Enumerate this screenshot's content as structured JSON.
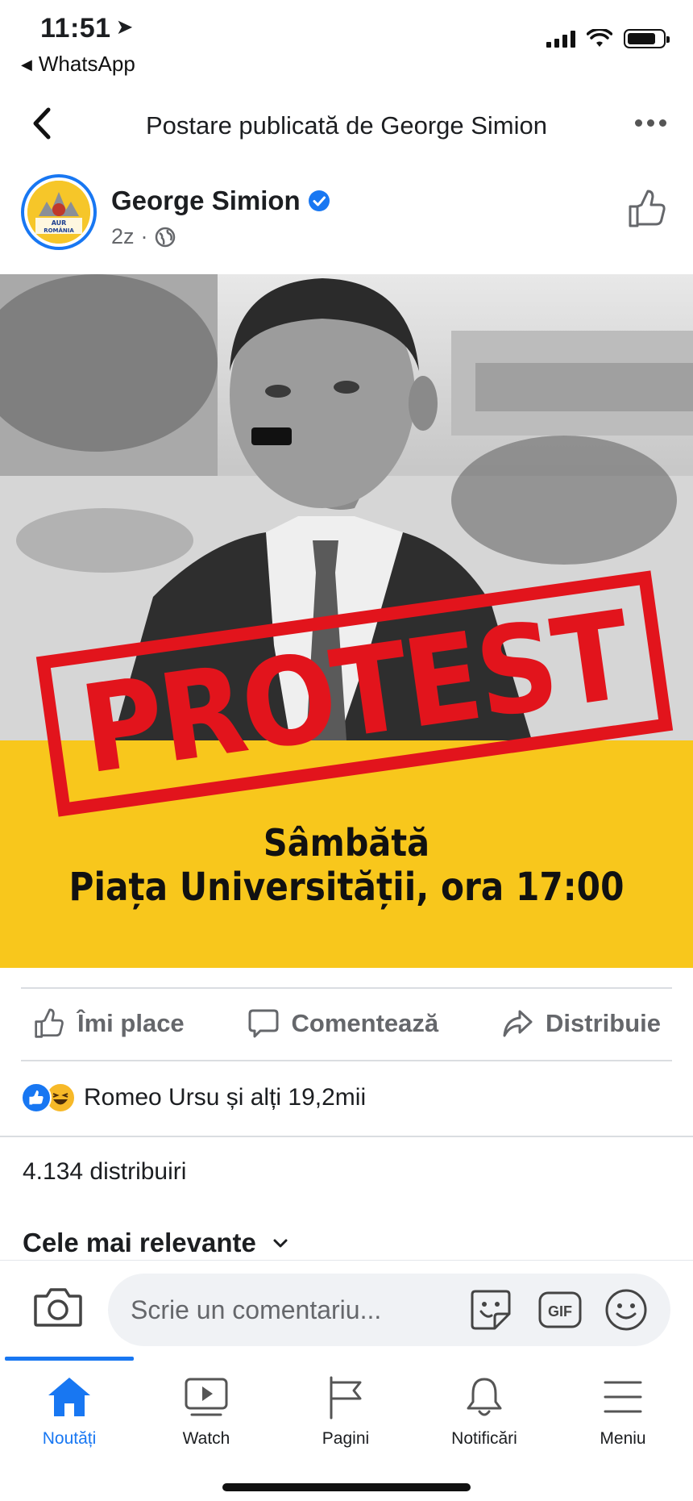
{
  "status_bar": {
    "time": "11:51",
    "back_app": "WhatsApp"
  },
  "header": {
    "title": "Postare publicată de George Simion"
  },
  "post": {
    "author": "George Simion",
    "time_ago": "2z",
    "meta_separator": "·",
    "avatar_text": "AUR pentru ROMÂNIA",
    "image": {
      "stamp_text": "PROTEST",
      "line1": "Sâmbătă",
      "line2": "Piața Universității, ora 17:00"
    },
    "actions": {
      "like": "Îmi place",
      "comment": "Comentează",
      "share": "Distribuie"
    },
    "reactions_text": "Romeo Ursu și alți 19,2mii",
    "shares": "4.134 distribuiri",
    "sort_label": "Cele mai relevante"
  },
  "composer": {
    "placeholder": "Scrie un comentariu...",
    "gif_label": "GIF"
  },
  "tabs": [
    {
      "label": "Noutăți",
      "icon": "home-icon",
      "active": true
    },
    {
      "label": "Watch",
      "icon": "watch-icon",
      "active": false
    },
    {
      "label": "Pagini",
      "icon": "flag-icon",
      "active": false
    },
    {
      "label": "Notificări",
      "icon": "bell-icon",
      "active": false
    },
    {
      "label": "Meniu",
      "icon": "menu-icon",
      "active": false
    }
  ],
  "colors": {
    "accent": "#1877f2",
    "stamp_red": "#e2141c",
    "band_yellow": "#f8c71c"
  }
}
